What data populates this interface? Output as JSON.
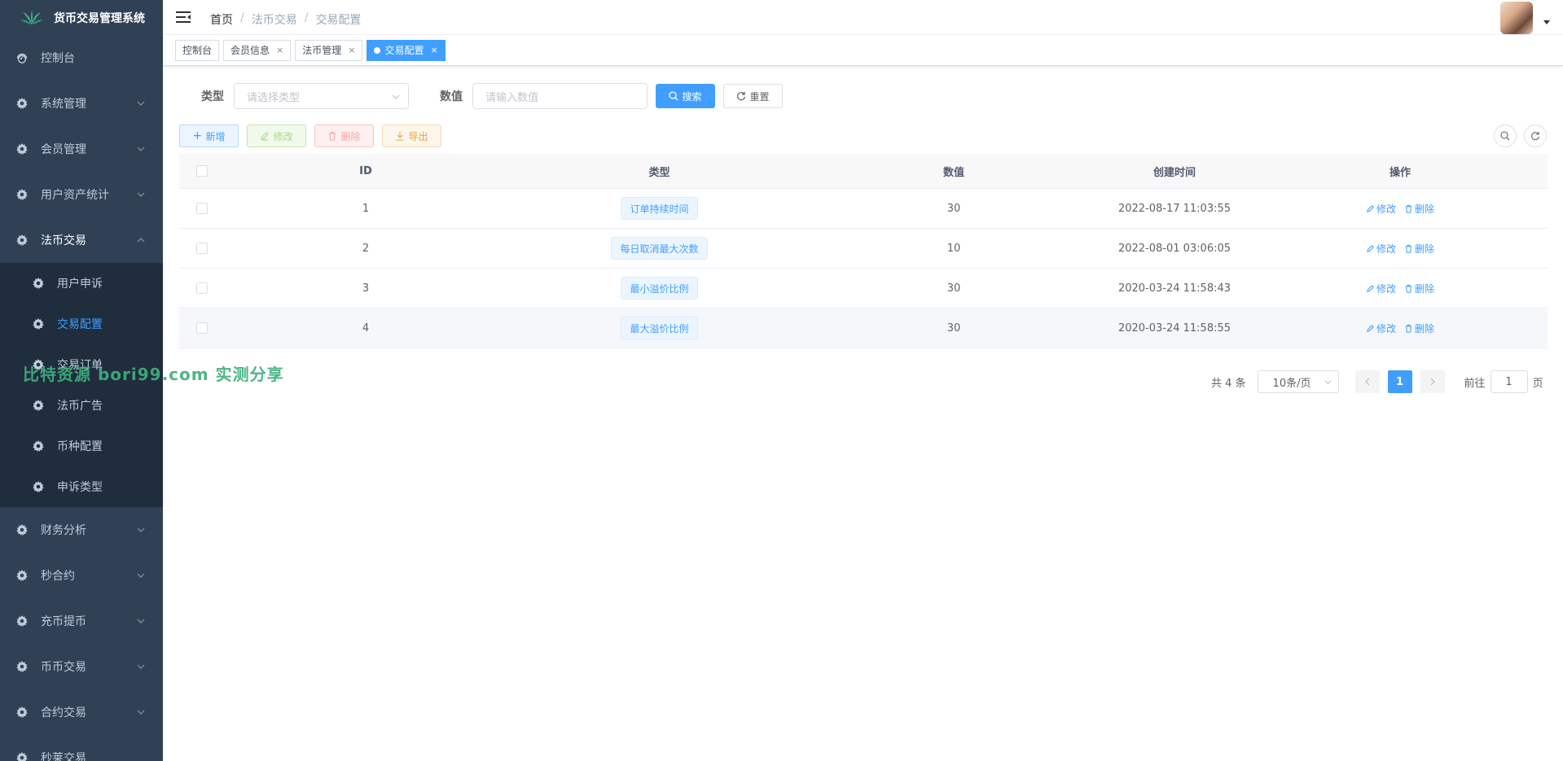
{
  "app": {
    "title": "货币交易管理系统"
  },
  "sidebar": {
    "items": [
      {
        "label": "控制台"
      },
      {
        "label": "系统管理"
      },
      {
        "label": "会员管理"
      },
      {
        "label": "用户资产统计"
      },
      {
        "label": "法币交易"
      },
      {
        "label": "财务分析"
      },
      {
        "label": "秒合约"
      },
      {
        "label": "充币提币"
      },
      {
        "label": "币币交易"
      },
      {
        "label": "合约交易"
      },
      {
        "label": "秒莱交易"
      }
    ],
    "submenu": [
      {
        "label": "用户申诉"
      },
      {
        "label": "交易配置"
      },
      {
        "label": "交易订单"
      },
      {
        "label": "法币广告"
      },
      {
        "label": "币种配置"
      },
      {
        "label": "申诉类型"
      }
    ]
  },
  "breadcrumb": [
    "首页",
    "法币交易",
    "交易配置"
  ],
  "tags": [
    {
      "label": "控制台"
    },
    {
      "label": "会员信息"
    },
    {
      "label": "法币管理"
    },
    {
      "label": "交易配置"
    }
  ],
  "close_glyph": "×",
  "form": {
    "type_label": "类型",
    "type_placeholder": "请选择类型",
    "value_label": "数值",
    "value_placeholder": "请输入数值",
    "search": "搜索",
    "reset": "重置"
  },
  "toolbar": {
    "add": "新增",
    "edit": "修改",
    "delete": "删除",
    "export": "导出"
  },
  "table": {
    "headers": {
      "id": "ID",
      "type": "类型",
      "value": "数值",
      "time": "创建时间",
      "op": "操作"
    },
    "op_edit": "修改",
    "op_delete": "删除",
    "rows": [
      {
        "id": "1",
        "type": "订单持续时间",
        "value": "30",
        "time": "2022-08-17 11:03:55"
      },
      {
        "id": "2",
        "type": "每日取消最大次数",
        "value": "10",
        "time": "2022-08-01 03:06:05"
      },
      {
        "id": "3",
        "type": "最小溢价比例",
        "value": "30",
        "time": "2020-03-24 11:58:43"
      },
      {
        "id": "4",
        "type": "最大溢价比例",
        "value": "30",
        "time": "2020-03-24 11:58:55"
      }
    ]
  },
  "pagination": {
    "total": "共 4 条",
    "page_size": "10条/页",
    "current": "1",
    "goto_prefix": "前往",
    "goto_value": "1",
    "goto_suffix": "页"
  },
  "watermark": "比特资源 bori99.com 实测分享",
  "colors": {
    "sidebar": "#304156",
    "submenu": "#1f2d3d",
    "accent": "#409eff"
  }
}
